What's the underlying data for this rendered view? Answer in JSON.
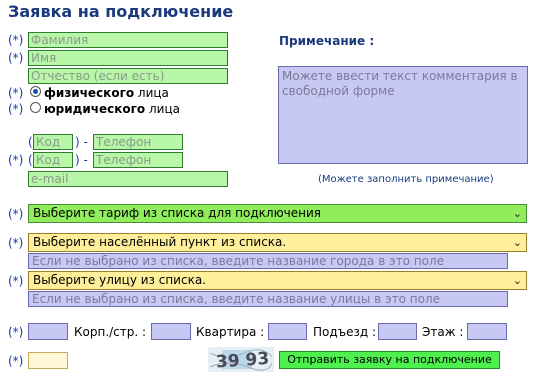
{
  "form": {
    "title": "Заявка на подключение",
    "required_mark": "(*)",
    "surname_placeholder": "Фамилия",
    "name_placeholder": "Имя",
    "patronymic_placeholder": "Отчество (если есть)",
    "person_type": {
      "individual_bold": "физического",
      "individual_rest": " лица",
      "legal_bold": "юридического",
      "legal_rest": " лица",
      "selected": "individual"
    },
    "phone1": {
      "open": "(",
      "code": "Код",
      "sep": ") -",
      "phone": "Телефон"
    },
    "phone2": {
      "open": "(",
      "code": "Код",
      "sep": ") -",
      "phone": "Телефон"
    },
    "email_placeholder": "e-mail",
    "note_label": "Примечание :",
    "note_placeholder": "Можете ввести текст комментария в свободной форме",
    "note_hint": "(Можете заполнить примечание)",
    "tariff_select": "Выберите тариф из списка для подключения",
    "city_select": "Выберите населённый пункт из списка.",
    "city_hint": "Если не выбрано из списка, введите название города в это поле",
    "street_select": "Выберите улицу из списка.",
    "street_hint": "Если не выбрано из списка, введите название улицы в это поле",
    "address": {
      "building_label": "Корп./стр. :",
      "apartment_label": "Квартира :",
      "entrance_label": "Подъезд :",
      "floor_label": "Этаж :"
    },
    "captcha_text": "39 93",
    "submit_label": "Отправить заявку на подключение",
    "colors": {
      "title": "#1a3a7c",
      "field_green": "#b8f7a8",
      "field_violet": "#c8c8f4",
      "select_green": "#90ee5c",
      "select_yellow": "#ffef9a",
      "submit_green": "#4ef04e"
    }
  }
}
